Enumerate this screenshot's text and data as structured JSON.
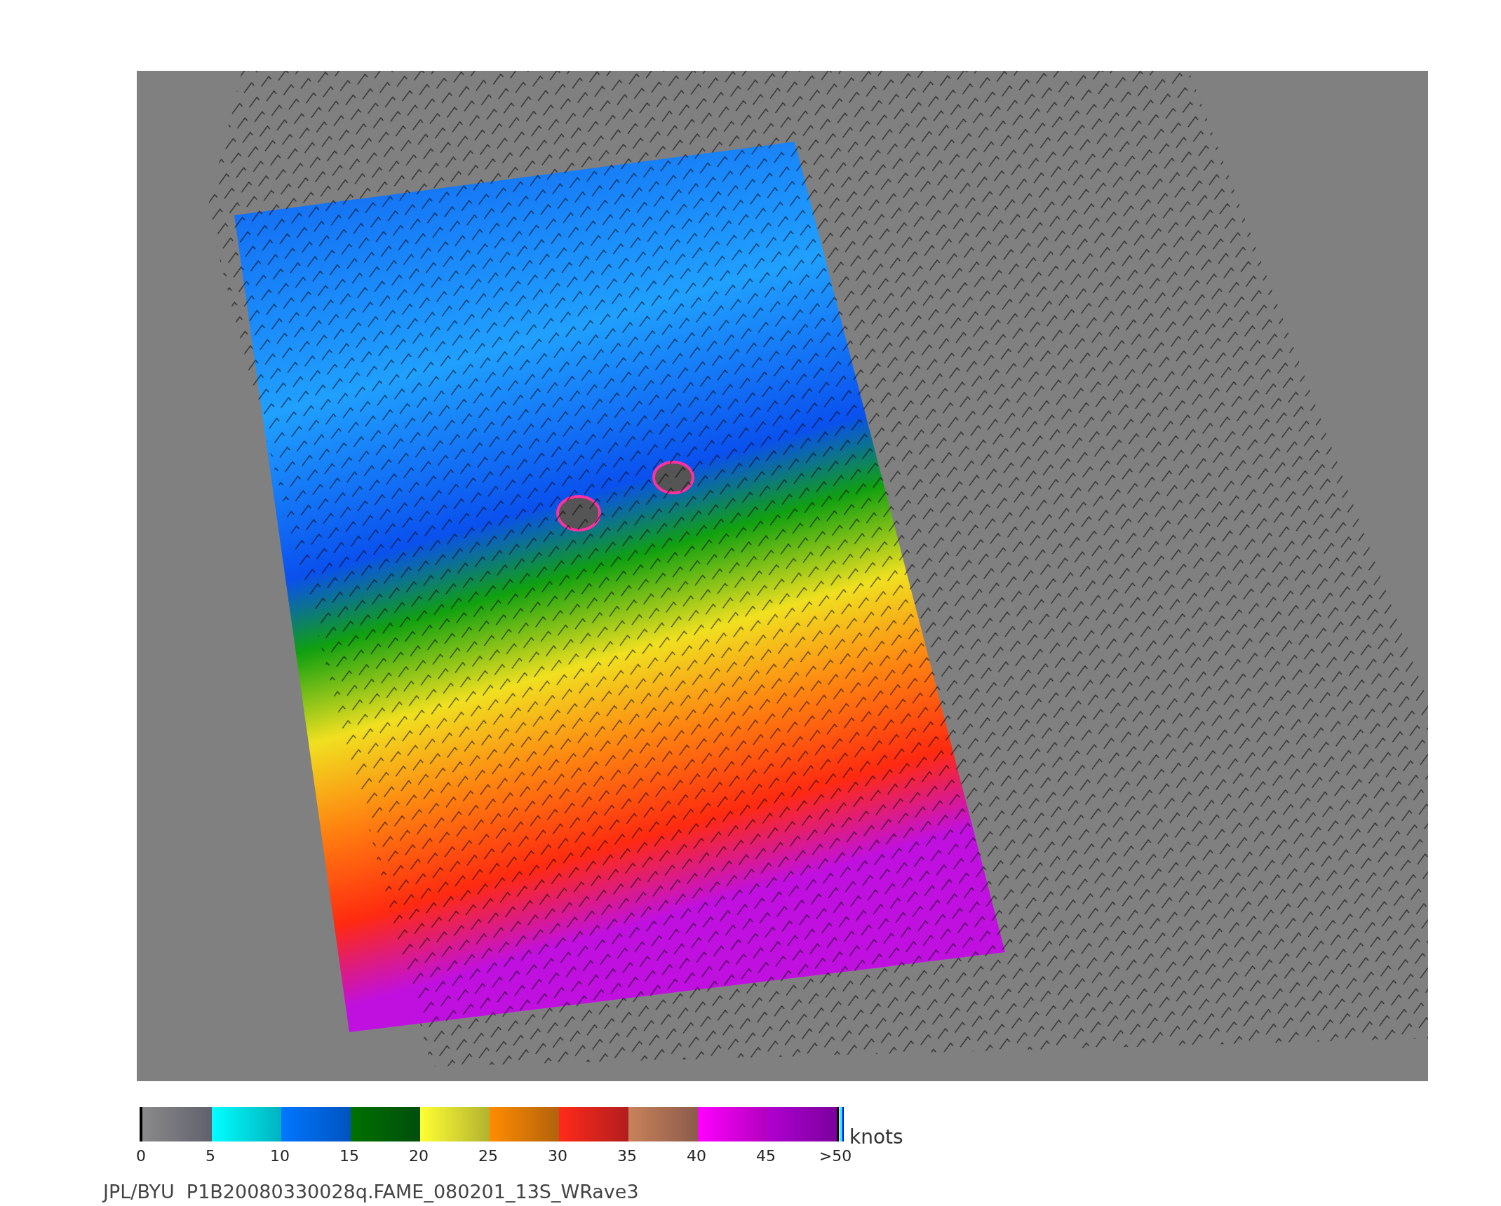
{
  "colorbar": {
    "segments": [
      {
        "color": "#8a8a8a"
      },
      {
        "color": "#00ffff"
      },
      {
        "color": "#0077ff"
      },
      {
        "color": "#007000"
      },
      {
        "color": "#ffff33"
      },
      {
        "color": "#ff8c00"
      },
      {
        "color": "#ff2a1a"
      },
      {
        "color": "#c8825a"
      },
      {
        "color": "#ff00ff"
      },
      {
        "color": "#b000d0"
      }
    ],
    "ticks": [
      "0",
      "5",
      "10",
      "15",
      "20",
      "25",
      "30",
      "35",
      "40",
      "45",
      ">50"
    ],
    "units": "knots"
  },
  "footer": "JPL/BYU  P1B20080330028q.FAME_080201_13S_WRave3"
}
